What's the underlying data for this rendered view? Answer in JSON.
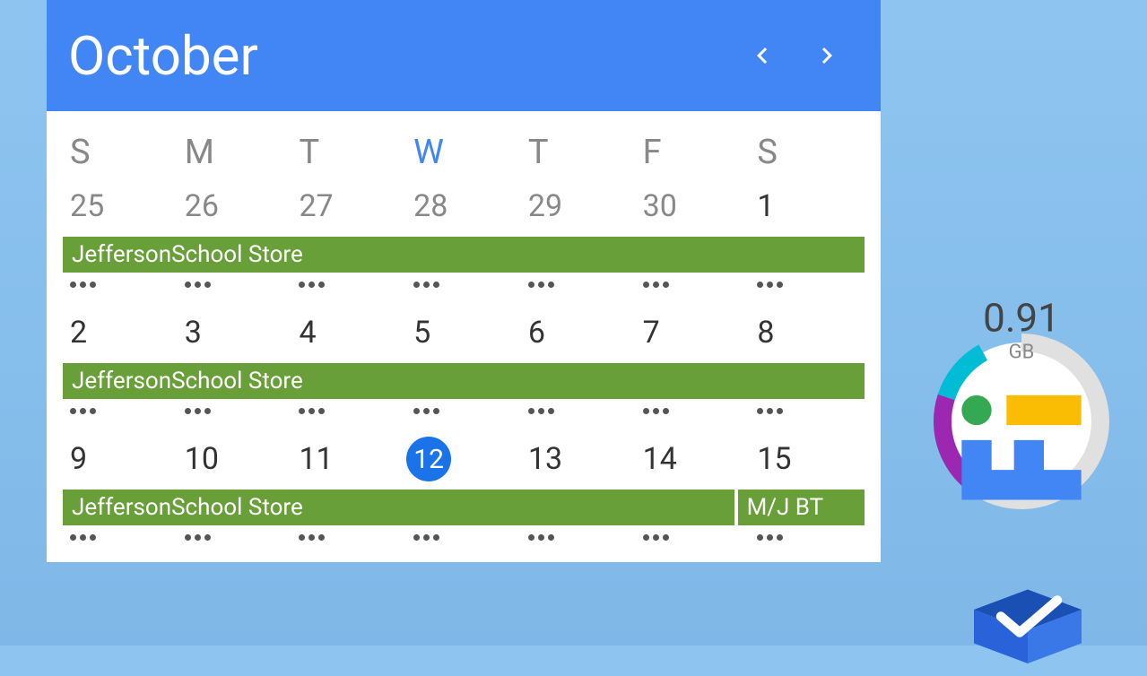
{
  "header": {
    "month": "October"
  },
  "dayHeaders": [
    "S",
    "M",
    "T",
    "W",
    "T",
    "F",
    "S"
  ],
  "activeDayIndex": 3,
  "weeks": [
    {
      "dates": [
        {
          "day": "25",
          "otherMonth": true
        },
        {
          "day": "26",
          "otherMonth": true
        },
        {
          "day": "27",
          "otherMonth": true
        },
        {
          "day": "28",
          "otherMonth": true
        },
        {
          "day": "29",
          "otherMonth": true
        },
        {
          "day": "30",
          "otherMonth": true
        },
        {
          "day": "1",
          "otherMonth": false
        }
      ],
      "events": [
        {
          "label": "JeffersonSchool Store",
          "span": 7
        }
      ],
      "hasDots": true
    },
    {
      "dates": [
        {
          "day": "2",
          "otherMonth": false
        },
        {
          "day": "3",
          "otherMonth": false
        },
        {
          "day": "4",
          "otherMonth": false
        },
        {
          "day": "5",
          "otherMonth": false
        },
        {
          "day": "6",
          "otherMonth": false
        },
        {
          "day": "7",
          "otherMonth": false
        },
        {
          "day": "8",
          "otherMonth": false
        }
      ],
      "events": [
        {
          "label": "JeffersonSchool Store",
          "span": 7
        }
      ],
      "hasDots": true
    },
    {
      "dates": [
        {
          "day": "9",
          "otherMonth": false
        },
        {
          "day": "10",
          "otherMonth": false
        },
        {
          "day": "11",
          "otherMonth": false
        },
        {
          "day": "12",
          "otherMonth": false,
          "today": true
        },
        {
          "day": "13",
          "otherMonth": false
        },
        {
          "day": "14",
          "otherMonth": false
        },
        {
          "day": "15",
          "otherMonth": false
        }
      ],
      "events": [
        {
          "label": "JeffersonSchool Store",
          "span": 6
        },
        {
          "label": "M/J BT",
          "span": 1,
          "truncated": true
        }
      ],
      "hasDots": true
    }
  ],
  "dataWidget": {
    "value": "0.91",
    "unit": "GB",
    "segments": [
      {
        "color": "#E0E0E0",
        "percent": 60,
        "offset": 0
      },
      {
        "color": "#9C27B0",
        "percent": 20,
        "offset": 60
      },
      {
        "color": "#00BCD4",
        "percent": 12,
        "offset": 80
      }
    ]
  }
}
